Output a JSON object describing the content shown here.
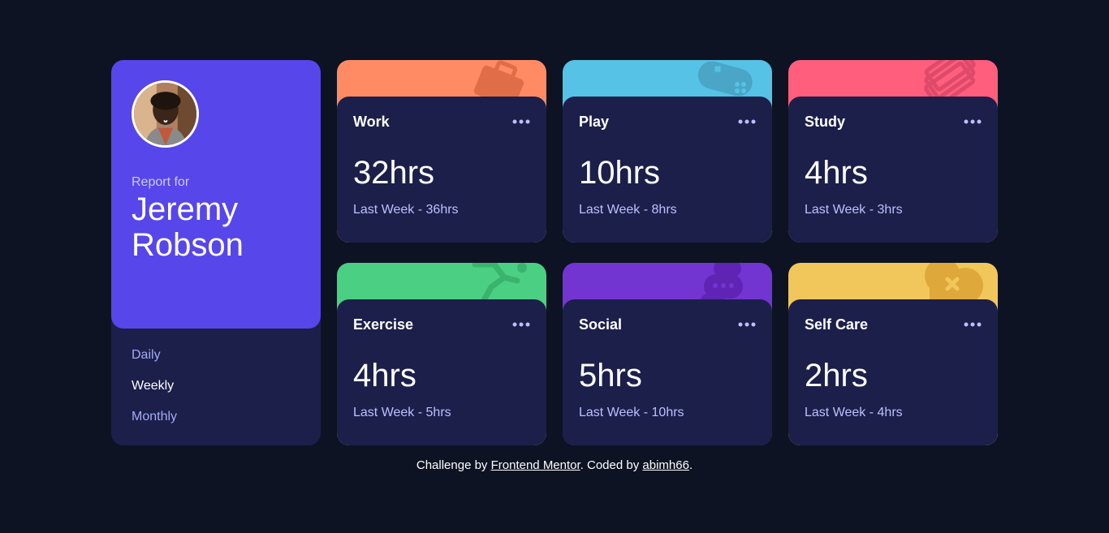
{
  "profile": {
    "report_label": "Report for",
    "name": "Jeremy Robson",
    "avatar": "user-avatar-photo"
  },
  "periods": [
    "Daily",
    "Weekly",
    "Monthly"
  ],
  "active_period": "Weekly",
  "cards": [
    {
      "title": "Work",
      "current": "32hrs",
      "previous": "Last Week - 36hrs",
      "color": "#ff8b64",
      "icon": "briefcase-icon"
    },
    {
      "title": "Play",
      "current": "10hrs",
      "previous": "Last Week - 8hrs",
      "color": "#55c2e6",
      "icon": "gamepad-icon"
    },
    {
      "title": "Study",
      "current": "4hrs",
      "previous": "Last Week - 3hrs",
      "color": "#ff5e7d",
      "icon": "books-icon"
    },
    {
      "title": "Exercise",
      "current": "4hrs",
      "previous": "Last Week - 5hrs",
      "color": "#4bcf82",
      "icon": "running-icon"
    },
    {
      "title": "Social",
      "current": "5hrs",
      "previous": "Last Week - 10hrs",
      "color": "#7335d2",
      "icon": "chat-bubbles-icon"
    },
    {
      "title": "Self Care",
      "current": "2hrs",
      "previous": "Last Week - 4hrs",
      "color": "#f1c75b",
      "icon": "heart-icon"
    }
  ],
  "footer": {
    "prefix": "Challenge by ",
    "link1": "Frontend Mentor",
    "middle": ". Coded by ",
    "link2": "abimh66",
    "suffix": "."
  },
  "colors": {
    "background": "#0d1323",
    "card": "#1c1f4a",
    "profile_accent": "#5746ea",
    "muted_text": "#bbc0ff"
  }
}
